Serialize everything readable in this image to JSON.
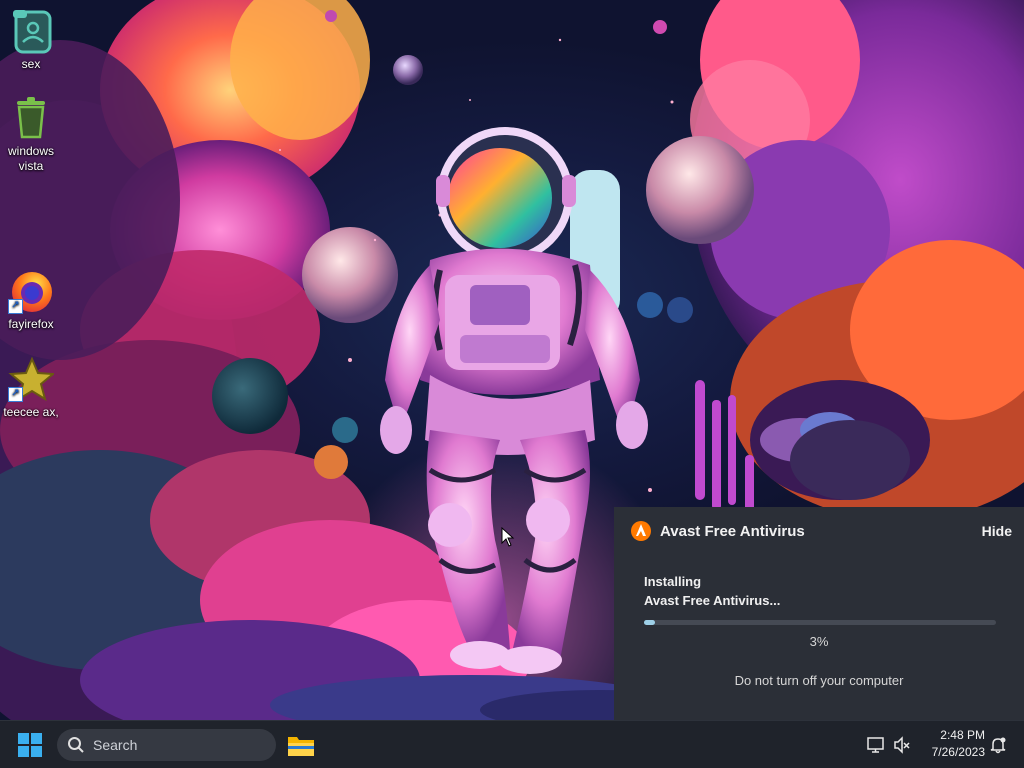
{
  "desktop": {
    "icons": [
      {
        "label": "sex",
        "icon": "user-folder-icon",
        "shortcut": false
      },
      {
        "label": "windows vista",
        "icon": "recycle-bin-icon",
        "shortcut": false
      },
      {
        "label": "fayirefox",
        "icon": "firefox-icon",
        "shortcut": true
      },
      {
        "label": "teecee ax,",
        "icon": "star-icon",
        "shortcut": true
      }
    ]
  },
  "avast": {
    "title": "Avast Free Antivirus",
    "hide_label": "Hide",
    "status_line1": "Installing",
    "status_line2": "Avast Free Antivirus...",
    "progress": 0.03,
    "progress_text": "3%",
    "note": "Do not turn off your computer",
    "accent_color": "#ff7a00"
  },
  "taskbar": {
    "search_placeholder": "Search",
    "time": "2:48 PM",
    "date": "7/26/2023",
    "tray_icons": [
      "network-icon",
      "volume-muted-icon",
      "notification-bell-icon"
    ]
  }
}
